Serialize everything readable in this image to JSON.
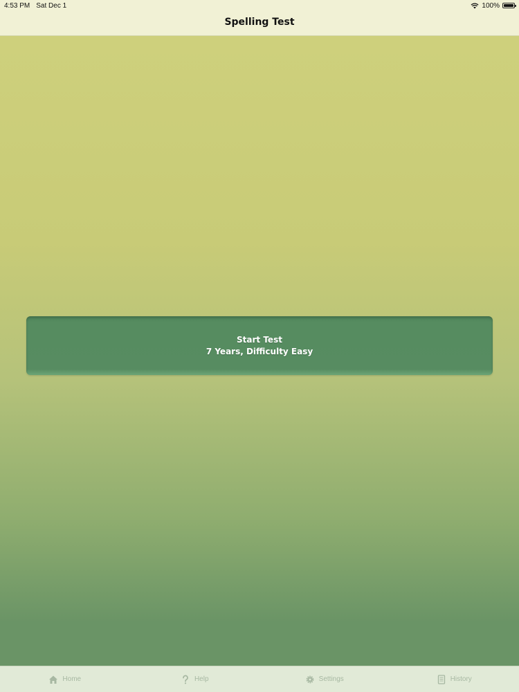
{
  "status_bar": {
    "time": "4:53 PM",
    "date": "Sat Dec 1",
    "battery": "100%",
    "battery_level": 1.0
  },
  "nav": {
    "title": "Spelling Test"
  },
  "start_button": {
    "line1": "Start Test",
    "line2": "7 Years, Difficulty Easy"
  },
  "tabs": [
    {
      "label": "Home",
      "icon": "home-icon"
    },
    {
      "label": "Help",
      "icon": "question-icon"
    },
    {
      "label": "Settings",
      "icon": "gear-icon"
    },
    {
      "label": "History",
      "icon": "document-icon"
    }
  ],
  "colors": {
    "nav_background": "#f1f1d5",
    "button_green": "#578c61",
    "tab_inactive": "#a7b8a2"
  }
}
